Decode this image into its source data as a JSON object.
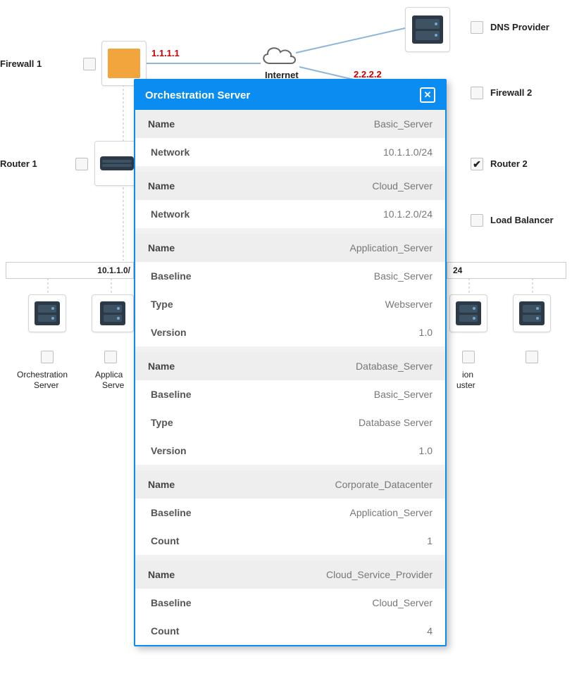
{
  "diagram": {
    "labels": {
      "firewall1": "Firewall 1",
      "router1": "Router 1",
      "dns": "DNS Provider",
      "firewall2": "Firewall 2",
      "router2": "Router 2",
      "loadbalancer": "Load Balancer",
      "internet": "Internet",
      "ip1": "1.1.1.1",
      "ip2": "2.2.2.2",
      "subnet_left": "10.1.1.0/",
      "subnet_right": "24",
      "orch_server": "Orchestration",
      "orch_server2": "Server",
      "app_server": "Applica",
      "app_server2": "Serve",
      "ion": "ion",
      "uster": "uster"
    },
    "checkboxes": {
      "firewall1": false,
      "router1": false,
      "dns": false,
      "firewall2": false,
      "router2": true,
      "loadbalancer": false
    }
  },
  "modal": {
    "title": "Orchestration Server",
    "groups": [
      {
        "rows": [
          {
            "key": "Name",
            "val": "Basic_Server",
            "header": true
          },
          {
            "key": "Network",
            "val": "10.1.1.0/24"
          }
        ]
      },
      {
        "rows": [
          {
            "key": "Name",
            "val": "Cloud_Server",
            "header": true
          },
          {
            "key": "Network",
            "val": "10.1.2.0/24"
          }
        ]
      },
      {
        "rows": [
          {
            "key": "Name",
            "val": "Application_Server",
            "header": true
          },
          {
            "key": "Baseline",
            "val": "Basic_Server"
          },
          {
            "key": "Type",
            "val": "Webserver"
          },
          {
            "key": "Version",
            "val": "1.0"
          }
        ]
      },
      {
        "rows": [
          {
            "key": "Name",
            "val": "Database_Server",
            "header": true
          },
          {
            "key": "Baseline",
            "val": "Basic_Server"
          },
          {
            "key": "Type",
            "val": "Database Server"
          },
          {
            "key": "Version",
            "val": "1.0"
          }
        ]
      },
      {
        "rows": [
          {
            "key": "Name",
            "val": "Corporate_Datacenter",
            "header": true
          },
          {
            "key": "Baseline",
            "val": "Application_Server"
          },
          {
            "key": "Count",
            "val": "1"
          }
        ]
      },
      {
        "rows": [
          {
            "key": "Name",
            "val": "Cloud_Service_Provider",
            "header": true
          },
          {
            "key": "Baseline",
            "val": "Cloud_Server"
          },
          {
            "key": "Count",
            "val": "4"
          }
        ]
      }
    ]
  }
}
